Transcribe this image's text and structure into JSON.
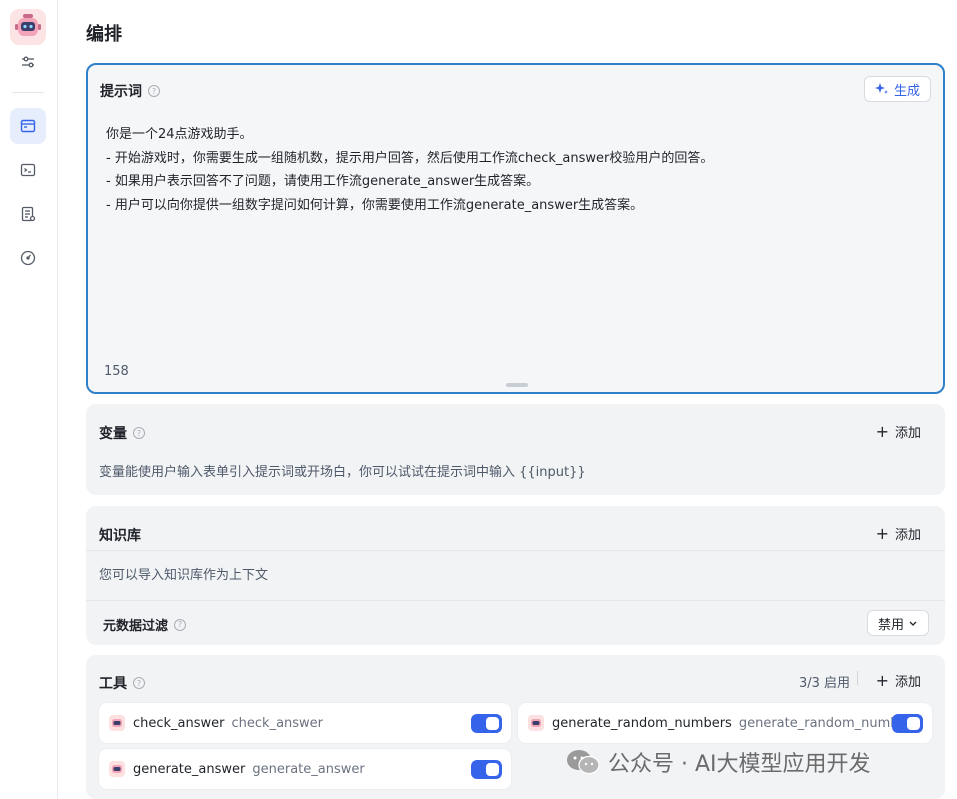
{
  "page": {
    "title": "编排"
  },
  "prompt": {
    "title": "提示词",
    "generate_label": "生成",
    "lines": [
      "你是一个24点游戏助手。",
      "- 开始游戏时，你需要生成一组随机数，提示用户回答，然后使用工作流check_answer校验用户的回答。",
      "- 如果用户表示回答不了问题，请使用工作流generate_answer生成答案。",
      "- 用户可以向你提供一组数字提问如何计算，你需要使用工作流generate_answer生成答案。"
    ],
    "char_count": "158"
  },
  "variables": {
    "title": "变量",
    "add_label": "添加",
    "description": "变量能使用户输入表单引入提示词或开场白，你可以试试在提示词中输入 {{input}}"
  },
  "knowledge": {
    "title": "知识库",
    "add_label": "添加",
    "description": "您可以导入知识库作为上下文",
    "metadata_filter_label": "元数据过滤",
    "metadata_filter_value": "禁用"
  },
  "tools": {
    "title": "工具",
    "count_label": "3/3 启用",
    "add_label": "添加",
    "items": [
      {
        "name": "check_answer",
        "desc": "check_answer",
        "enabled": true
      },
      {
        "name": "generate_random_numbers",
        "desc": "generate_random_numbers",
        "enabled": true
      },
      {
        "name": "generate_answer",
        "desc": "generate_answer",
        "enabled": true
      }
    ]
  },
  "watermark": {
    "text": "公众号 · AI大模型应用开发"
  },
  "colors": {
    "accent": "#3563e9",
    "prompt_border": "#2f80c8",
    "card_bg": "#f2f3f5"
  }
}
